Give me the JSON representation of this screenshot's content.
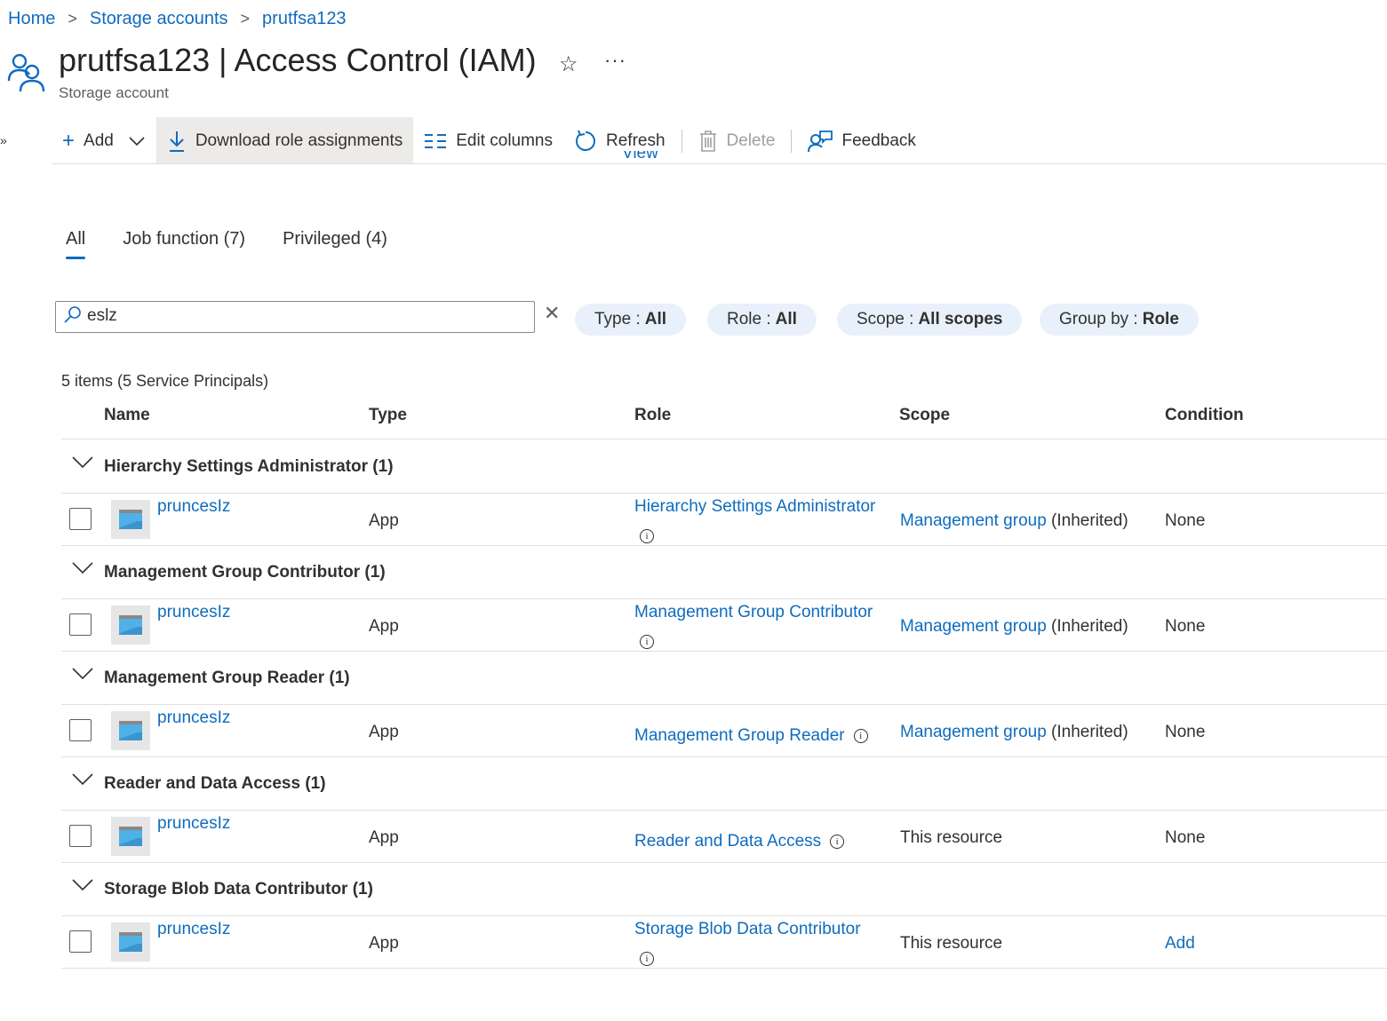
{
  "breadcrumb": {
    "items": [
      "Home",
      "Storage accounts",
      "prutfsa123"
    ],
    "separator": ">"
  },
  "header": {
    "title": "prutfsa123 | Access Control (IAM)",
    "subtitle": "Storage account",
    "favorite_icon": "star-icon",
    "more_icon": "ellipsis-icon",
    "favorite_glyph": "☆",
    "more_glyph": "···",
    "expand_glyph": "»"
  },
  "toolbar": {
    "add_label": "Add",
    "download_label": "Download role assignments",
    "edit_columns_label": "Edit columns",
    "refresh_label": "Refresh",
    "delete_label": "Delete",
    "feedback_label": "Feedback"
  },
  "partial_link": "View assignments",
  "tabs": [
    {
      "label": "All",
      "active": true
    },
    {
      "label": "Job function (7)",
      "active": false
    },
    {
      "label": "Privileged (4)",
      "active": false
    }
  ],
  "search": {
    "value": "eslz",
    "clear_glyph": "✕"
  },
  "filters": [
    {
      "key": "Type",
      "value": "All"
    },
    {
      "key": "Role",
      "value": "All"
    },
    {
      "key": "Scope",
      "value": "All scopes"
    },
    {
      "key": "Group by",
      "value": "Role"
    }
  ],
  "items_count": "5 items (5 Service Principals)",
  "table": {
    "columns": [
      "Name",
      "Type",
      "Role",
      "Scope",
      "Condition"
    ],
    "groups": [
      {
        "label": "Hierarchy Settings Administrator (1)",
        "row": {
          "name": "pruncesIz",
          "type": "App",
          "role": "Hierarchy Settings Administrator",
          "scope_link": "Management group",
          "scope_suffix": " (Inherited)",
          "condition": "None",
          "condition_is_link": false
        }
      },
      {
        "label": "Management Group Contributor (1)",
        "row": {
          "name": "pruncesIz",
          "type": "App",
          "role": "Management Group Contributor",
          "scope_link": "Management group",
          "scope_suffix": " (Inherited)",
          "condition": "None",
          "condition_is_link": false
        }
      },
      {
        "label": "Management Group Reader (1)",
        "row": {
          "name": "pruncesIz",
          "type": "App",
          "role": "Management Group Reader",
          "scope_link": "Management group",
          "scope_suffix": " (Inherited)",
          "condition": "None",
          "condition_is_link": false
        }
      },
      {
        "label": "Reader and Data Access (1)",
        "row": {
          "name": "pruncesIz",
          "type": "App",
          "role": "Reader and Data Access",
          "scope_text": "This resource",
          "condition": "None",
          "condition_is_link": false
        }
      },
      {
        "label": "Storage Blob Data Contributor (1)",
        "row": {
          "name": "pruncesIz",
          "type": "App",
          "role": "Storage Blob Data Contributor",
          "scope_text": "This resource",
          "condition": "Add",
          "condition_is_link": true
        }
      }
    ]
  },
  "colors": {
    "accent": "#0f6cbd",
    "pill_background": "#e8f1fb",
    "toolbar_highlight": "#edebe9"
  }
}
